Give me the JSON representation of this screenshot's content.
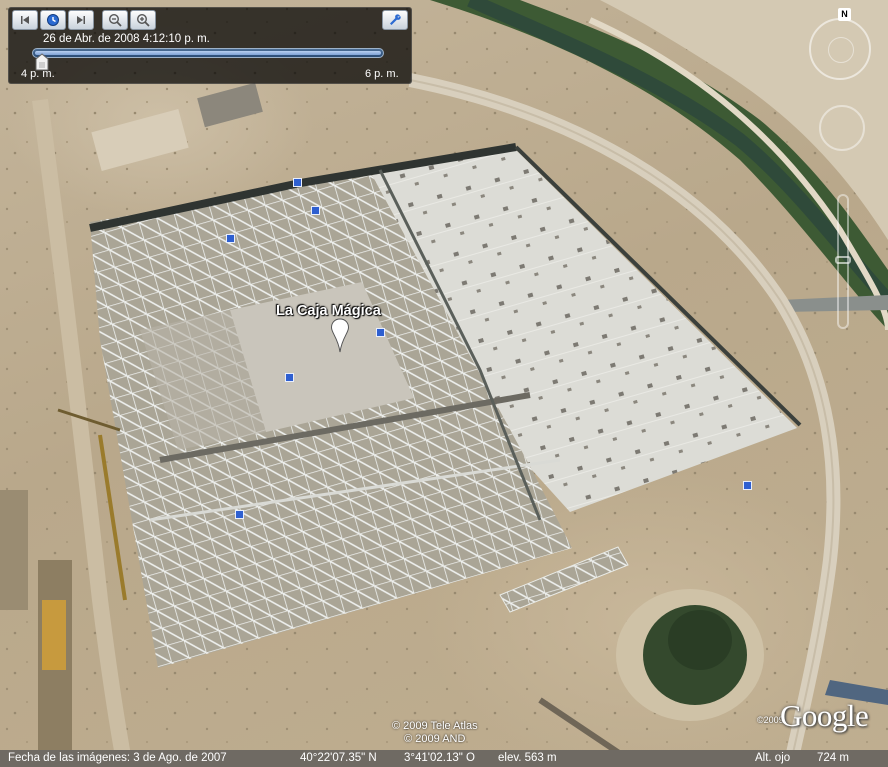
{
  "time_slider": {
    "date_label": "26 de Abr. de 2008   4:12:10 p. m.",
    "start_label": "4 p. m.",
    "end_label": "6 p. m.",
    "position_fraction": 0.05
  },
  "placemark": {
    "label": "La Caja Mágica"
  },
  "nav": {
    "north_label": "N"
  },
  "copyright": {
    "line1": "© 2009 Tele Atlas",
    "line2": "© 2009 AND"
  },
  "logo": {
    "text": "Google",
    "year": "©2009"
  },
  "status_bar": {
    "imagery_date": "Fecha de las imágenes:  3 de Ago. de 2007",
    "latitude": "40°22'07.35\" N",
    "longitude": "3°41'02.13\" O",
    "elevation": "elev.  563 m",
    "eye_alt_label": "Alt. ojo",
    "eye_alt_value": "724 m"
  },
  "colors": {
    "panel": "#000000",
    "marker": "#2e5fd0",
    "status_bar": "#6f6a63"
  },
  "icons": [
    "skip-back-icon",
    "clock-icon",
    "skip-forward-icon",
    "zoom-out-icon",
    "zoom-in-icon",
    "wrench-icon",
    "placemark-pin-icon"
  ]
}
